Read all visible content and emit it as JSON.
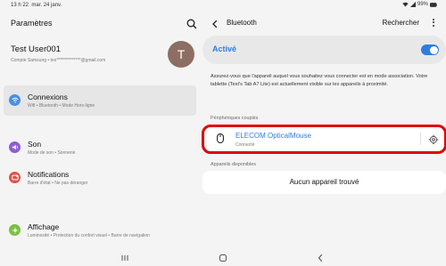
{
  "status_bar": {
    "time": "13 h 22",
    "date": "mar. 24 janv.",
    "battery": "99%",
    "icons": [
      "wifi-icon",
      "signal-icon",
      "battery-icon"
    ]
  },
  "left": {
    "title": "Paramètres",
    "account": {
      "name": "Test User001",
      "sub": "Compte Samsung  •  tes**************@gmail.com",
      "avatar_letter": "T"
    },
    "items": [
      {
        "title": "Connexions",
        "sub": "Wifi  •  Bluetooth  •  Mode Hors-ligne",
        "icon": "wifi-icon",
        "color": "#4a90e2"
      },
      {
        "title": "Son",
        "sub": "Mode de son  •  Sonnerie",
        "icon": "sound-icon",
        "color": "#8e5dd6"
      },
      {
        "title": "Notifications",
        "sub": "Barre d'état  •  Ne pas déranger",
        "icon": "notification-icon",
        "color": "#e0534a"
      },
      {
        "title": "Affichage",
        "sub": "Luminosité  •  Protection du confort visuel  •  Barre de navigation",
        "icon": "display-icon",
        "color": "#7bbf3f"
      }
    ]
  },
  "right": {
    "title": "Bluetooth",
    "search_label": "Rechercher",
    "toggle_label": "Activé",
    "toggle_on": true,
    "description": "Assurez-vous que l'appareil auquel vous souhaitez vous connecter est en mode association. Votre tablette (Test's Tab A7 Lite) est actuellement visible sur les appareils à proximité.",
    "paired_section": "Périphériques couplés",
    "paired_device": {
      "name": "ELECOM OpticalMouse",
      "status": "Connecté"
    },
    "available_section": "Appareils disponibles",
    "available_empty": "Aucun appareil trouvé"
  },
  "colors": {
    "accent": "#2f7de1",
    "highlight": "#e00000"
  }
}
